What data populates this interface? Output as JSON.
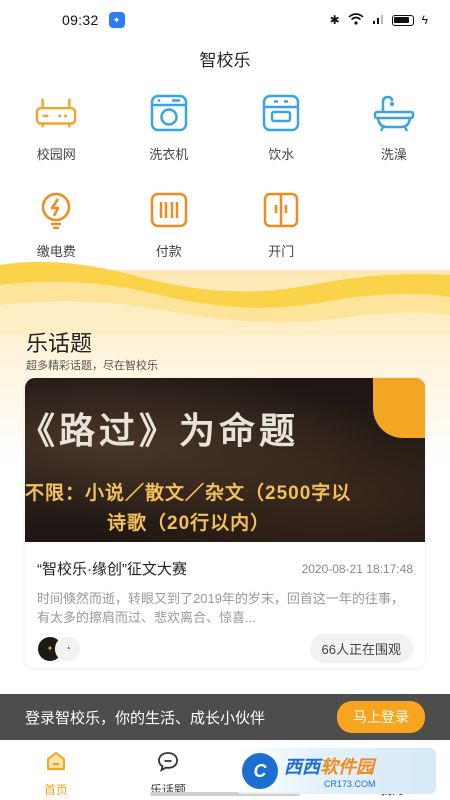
{
  "status": {
    "time": "09:32"
  },
  "header": {
    "title": "智校乐"
  },
  "services": [
    {
      "label": "校园网",
      "icon": "router-icon"
    },
    {
      "label": "洗衣机",
      "icon": "washing-machine-icon"
    },
    {
      "label": "饮水",
      "icon": "water-dispenser-icon"
    },
    {
      "label": "洗澡",
      "icon": "bathtub-icon"
    },
    {
      "label": "缴电费",
      "icon": "lightbulb-icon"
    },
    {
      "label": "付款",
      "icon": "payment-icon"
    },
    {
      "label": "开门",
      "icon": "door-icon"
    }
  ],
  "topics": {
    "title": "乐话题",
    "subtitle": "超多精彩话题，尽在智校乐",
    "card": {
      "banner_line1": "《路过》为命题",
      "banner_line2": "不限：小说／散文／杂文（2500字以",
      "banner_line3": "诗歌（20行以内）",
      "title": "“智校乐·缘创”征文大赛",
      "date": "2020-08-21 18:17:48",
      "excerpt": "时间倏然而逝，转眼又到了2019年的岁末，回首这一年的往事，有太多的擦肩而过、悲欢离合、惊喜...",
      "viewers": "66人正在围观"
    }
  },
  "login_bar": {
    "text": "登录智校乐，你的生活、成长小伙伴",
    "button": "马上登录"
  },
  "tabs": [
    {
      "label": "首页",
      "active": true
    },
    {
      "label": "乐话题",
      "active": false
    },
    {
      "label": "",
      "active": false
    },
    {
      "label": "我的",
      "active": false
    }
  ],
  "watermark": {
    "main_a": "西西",
    "main_b": "软件园",
    "sub": "CR173.COM"
  },
  "colors": {
    "accent": "#f2a624",
    "icon_blue": "#3aa4e0",
    "icon_orange": "#f28a1e",
    "bar": "#4d4d4d"
  }
}
